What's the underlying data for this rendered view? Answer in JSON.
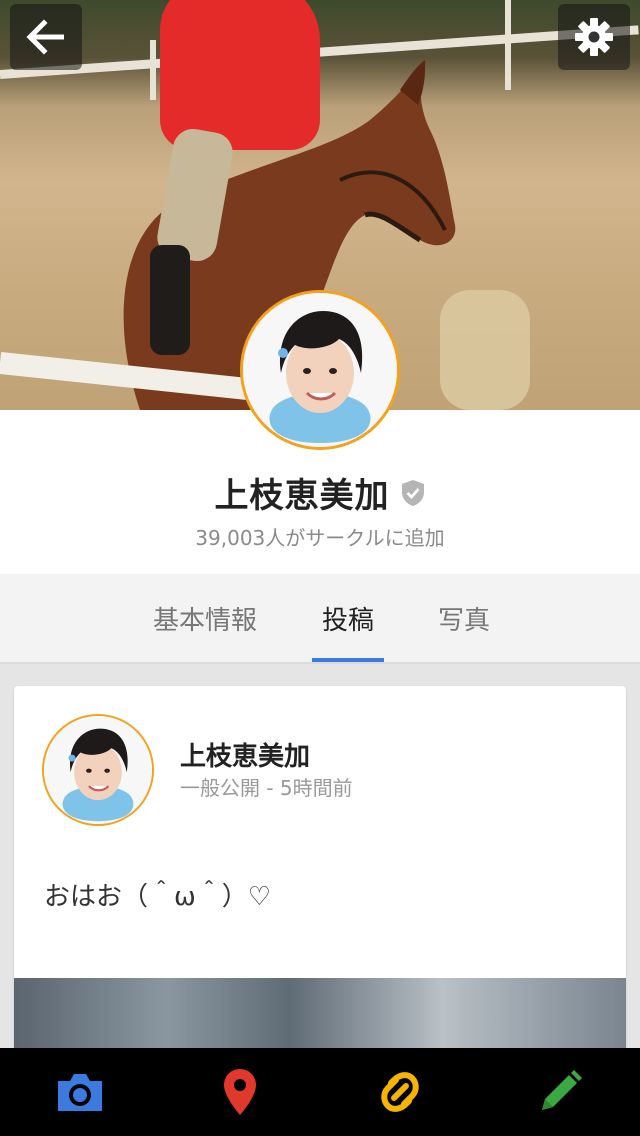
{
  "profile": {
    "name": "上枝恵美加",
    "followers_text": "39,003人がサークルに追加"
  },
  "tabs": [
    {
      "label": "基本情報",
      "active": false
    },
    {
      "label": "投稿",
      "active": true
    },
    {
      "label": "写真",
      "active": false
    }
  ],
  "post": {
    "author": "上枝恵美加",
    "meta": "一般公開 - 5時間前",
    "text": "おはお（＾ω＾）♡"
  },
  "icons": {
    "back": "back-arrow-icon",
    "settings": "gear-icon",
    "verified": "verified-shield-icon",
    "camera": "camera-icon",
    "place": "map-pin-icon",
    "link": "link-icon",
    "edit": "pencil-icon"
  },
  "colors": {
    "tab_accent": "#3b7be0",
    "avatar_ring": "#f4a21d",
    "camera": "#3b7be0",
    "place": "#e0382b",
    "link": "#f5b400",
    "edit": "#3aa843"
  }
}
